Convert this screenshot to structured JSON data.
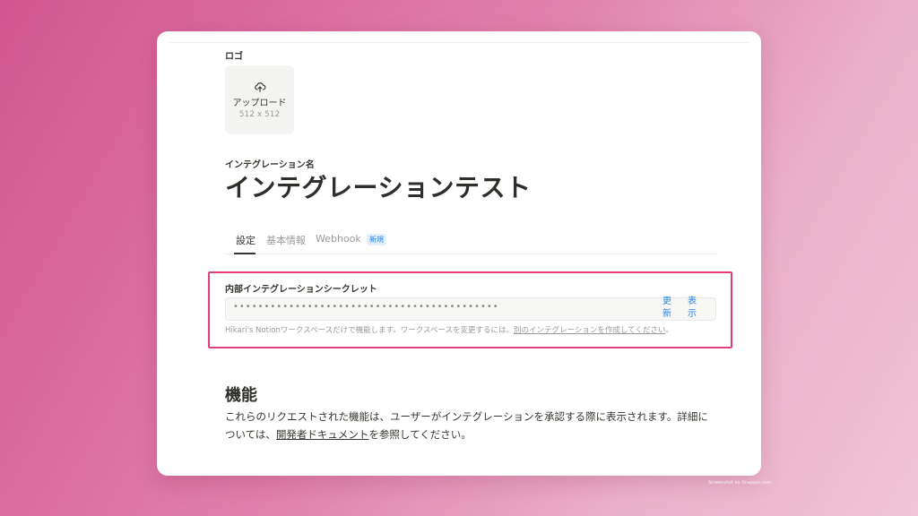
{
  "logo": {
    "label": "ロゴ",
    "upload_text": "アップロード",
    "upload_size": "512 x 512",
    "icon": "cloud-upload-icon"
  },
  "integration": {
    "name_label": "インテグレーション名",
    "title": "インテグレーションテスト"
  },
  "tabs": [
    {
      "label": "設定",
      "active": true
    },
    {
      "label": "基本情報",
      "active": false
    },
    {
      "label": "Webhook",
      "active": false
    }
  ],
  "tab_badge": "新規",
  "secret": {
    "label": "内部インテグレーションシークレット",
    "masked_value": "•••••••••••••••••••••••••••••••••••••••••••",
    "refresh_label": "更新",
    "show_label": "表示",
    "help_prefix": "Hikari's Notionワークスペースだけで機能します。ワークスペースを変更するには、",
    "help_link": "別のインテグレーションを作成してください",
    "help_suffix": "。"
  },
  "capabilities": {
    "title": "機能",
    "body_part1": "これらのリクエストされた機能は、ユーザーがインテグレーションを承認する際に表示されます。詳細については、",
    "body_link": "開発者ドキュメント",
    "body_part2": "を参照してください。"
  },
  "watermark": "Screenshot by Xnapper.com",
  "colors": {
    "accent": "#2383e2",
    "highlight_border": "#e23f7e",
    "text": "#37352f"
  }
}
